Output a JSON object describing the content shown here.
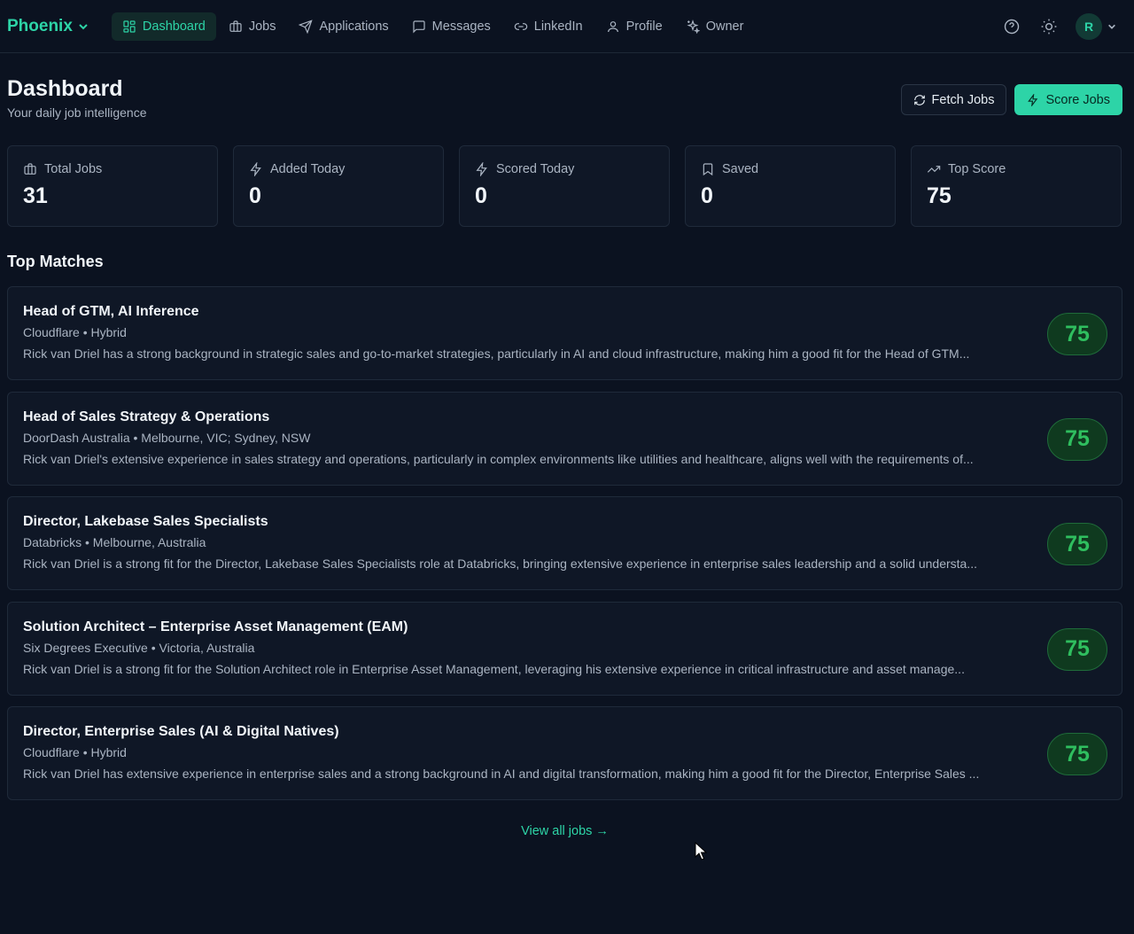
{
  "nav": {
    "brand": "Phoenix",
    "items": [
      {
        "label": "Dashboard",
        "icon": "grid-icon",
        "active": true
      },
      {
        "label": "Jobs",
        "icon": "briefcase-icon"
      },
      {
        "label": "Applications",
        "icon": "send-icon"
      },
      {
        "label": "Messages",
        "icon": "message-icon"
      },
      {
        "label": "LinkedIn",
        "icon": "link-icon"
      },
      {
        "label": "Profile",
        "icon": "user-icon"
      },
      {
        "label": "Owner",
        "icon": "sparkles-icon"
      }
    ],
    "right": {
      "help_icon": "help-circle-icon",
      "theme_icon": "sun-icon",
      "avatar_initial": "R"
    }
  },
  "header": {
    "title": "Dashboard",
    "subtitle": "Your daily job intelligence",
    "fetch_label": "Fetch Jobs",
    "score_label": "Score Jobs"
  },
  "stats": [
    {
      "label": "Total Jobs",
      "value": "31",
      "icon": "briefcase-icon"
    },
    {
      "label": "Added Today",
      "value": "0",
      "icon": "zap-icon"
    },
    {
      "label": "Scored Today",
      "value": "0",
      "icon": "zap-icon"
    },
    {
      "label": "Saved",
      "value": "0",
      "icon": "bookmark-icon"
    },
    {
      "label": "Top Score",
      "value": "75",
      "icon": "trending-up-icon"
    }
  ],
  "top_matches": {
    "title": "Top Matches",
    "items": [
      {
        "title": "Head of GTM, AI Inference",
        "meta": "Cloudflare • Hybrid",
        "desc": "Rick van Driel has a strong background in strategic sales and go-to-market strategies, particularly in AI and cloud infrastructure, making him a good fit for the Head of GTM...",
        "score": "75"
      },
      {
        "title": "Head of Sales Strategy & Operations",
        "meta": "DoorDash Australia • Melbourne, VIC; Sydney, NSW",
        "desc": "Rick van Driel's extensive experience in sales strategy and operations, particularly in complex environments like utilities and healthcare, aligns well with the requirements of...",
        "score": "75"
      },
      {
        "title": "Director, Lakebase Sales Specialists",
        "meta": "Databricks • Melbourne, Australia",
        "desc": "Rick van Driel is a strong fit for the Director, Lakebase Sales Specialists role at Databricks, bringing extensive experience in enterprise sales leadership and a solid understa...",
        "score": "75"
      },
      {
        "title": "Solution Architect – Enterprise Asset Management (EAM)",
        "meta": "Six Degrees Executive • Victoria, Australia",
        "desc": "Rick van Driel is a strong fit for the Solution Architect role in Enterprise Asset Management, leveraging his extensive experience in critical infrastructure and asset manage...",
        "score": "75"
      },
      {
        "title": "Director, Enterprise Sales (AI & Digital Natives)",
        "meta": "Cloudflare • Hybrid",
        "desc": "Rick van Driel has extensive experience in enterprise sales and a strong background in AI and digital transformation, making him a good fit for the Director, Enterprise Sales ...",
        "score": "75"
      }
    ],
    "view_all": "View all jobs →"
  },
  "colors": {
    "accent": "#2dd4a7",
    "background": "#0b1220",
    "card": "#0f1726",
    "score": "#2fbe5f"
  }
}
